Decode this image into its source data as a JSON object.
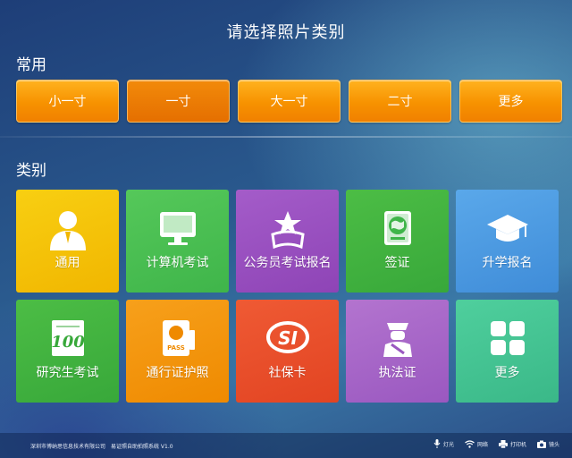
{
  "page_title": "请选择照片类别",
  "common": {
    "label": "常用",
    "items": [
      {
        "label": "小一寸"
      },
      {
        "label": "一寸"
      },
      {
        "label": "大一寸"
      },
      {
        "label": "二寸"
      },
      {
        "label": "更多"
      }
    ]
  },
  "categories": {
    "label": "类别",
    "items": [
      {
        "label": "通用",
        "icon": "person-icon",
        "color": "#f4c20b"
      },
      {
        "label": "计算机考试",
        "icon": "monitor-icon",
        "color": "#4cc257"
      },
      {
        "label": "公务员考试报名",
        "icon": "star-badge-icon",
        "color": "#9a4fc0"
      },
      {
        "label": "签证",
        "icon": "globe-book-icon",
        "color": "#3fb54a"
      },
      {
        "label": "升学报名",
        "icon": "graduation-cap-icon",
        "color": "#4e9ce2"
      },
      {
        "label": "研究生考试",
        "icon": "score-100-icon",
        "color": "#42b83f"
      },
      {
        "label": "通行证护照",
        "icon": "passport-icon",
        "color": "#f39614"
      },
      {
        "label": "社保卡",
        "icon": "si-logo-icon",
        "color": "#e84f2b"
      },
      {
        "label": "执法证",
        "icon": "officer-icon",
        "color": "#a865c8"
      },
      {
        "label": "更多",
        "icon": "grid-more-icon",
        "color": "#42c493"
      }
    ]
  },
  "footer": {
    "company": "深圳市博纳思信息技术有限公司",
    "system": "易证照自助拍照系统 V1.0",
    "status": [
      {
        "label": "灯光",
        "icon": "microphone-icon"
      },
      {
        "label": "网络",
        "icon": "wifi-icon"
      },
      {
        "label": "打印机",
        "icon": "printer-icon"
      },
      {
        "label": "镜头",
        "icon": "camera-icon"
      }
    ]
  }
}
